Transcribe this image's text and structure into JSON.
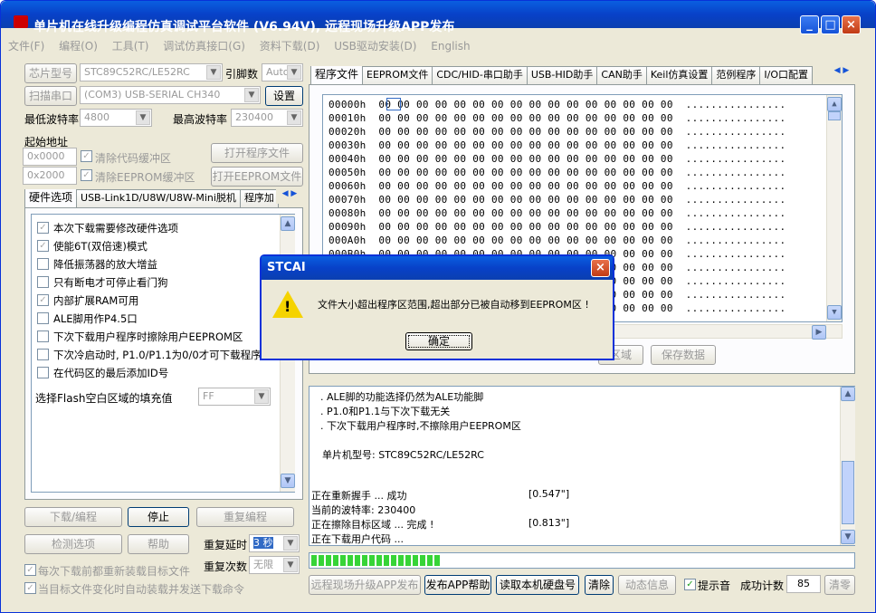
{
  "window": {
    "title": "单片机在线升级编程仿真调试平台软件 (V6.94V), 远程现场升级APP发布"
  },
  "menu": [
    "文件(F)",
    "编程(O)",
    "工具(T)",
    "调试仿真接口(G)",
    "资料下载(D)",
    "USB驱动安装(D)",
    "English"
  ],
  "left": {
    "chip_label": "芯片型号",
    "chip_value": "STC89C52RC/LE52RC",
    "pin_label": "引脚数",
    "pin_value": "Auto",
    "scan_label": "扫描串口",
    "port_value": "(COM3) USB-SERIAL CH340",
    "settings_label": "设置",
    "min_baud_label": "最低波特率",
    "min_baud_value": "4800",
    "max_baud_label": "最高波特率",
    "max_baud_value": "230400",
    "start_addr_label": "起始地址",
    "addr1_prefix": "0x",
    "addr1": "0000",
    "clear_code_label": "清除代码缓冲区",
    "open_prog_label": "打开程序文件",
    "addr2_prefix": "0x",
    "addr2": "2000",
    "clear_eeprom_label": "清除EEPROM缓冲区",
    "open_eeprom_label": "打开EEPROM文件",
    "subtabs": [
      "硬件选项",
      "USB-Link1D/U8W/U8W-Mini脱机",
      "程序加"
    ],
    "options": [
      {
        "label": "本次下载需要修改硬件选项",
        "checked": true
      },
      {
        "label": "使能6T(双倍速)模式",
        "checked": true
      },
      {
        "label": "降低振荡器的放大增益",
        "checked": false
      },
      {
        "label": "只有断电才可停止看门狗",
        "checked": false
      },
      {
        "label": "内部扩展RAM可用",
        "checked": true
      },
      {
        "label": "ALE脚用作P4.5口",
        "checked": false
      },
      {
        "label": "下次下载用户程序时擦除用户EEPROM区",
        "checked": false
      },
      {
        "label": "下次冷启动时, P1.0/P1.1为0/0才可下载程序",
        "checked": false
      },
      {
        "label": "在代码区的最后添加ID号",
        "checked": false
      }
    ],
    "fill_label": "选择Flash空白区域的填充值",
    "fill_value": "FF",
    "download_label": "下载/编程",
    "stop_label": "停止",
    "reprogram_label": "重复编程",
    "check_label": "检测选项",
    "help_label": "帮助",
    "repeat_delay_label": "重复延时",
    "repeat_delay_value": "3 秒",
    "repeat_count_label": "重复次数",
    "repeat_count_value": "无限",
    "reload_label": "每次下载前都重新装载目标文件",
    "autoload_label": "当目标文件变化时自动装载并发送下载命令"
  },
  "right": {
    "tabs": [
      "程序文件",
      "EEPROM文件",
      "CDC/HID-串口助手",
      "USB-HID助手",
      "CAN助手",
      "Keil仿真设置",
      "范例程序",
      "I/O口配置"
    ],
    "hex_rows": [
      "00000h",
      "00010h",
      "00020h",
      "00030h",
      "00040h",
      "00050h",
      "00060h",
      "00070h",
      "00080h",
      "00090h",
      "000A0h",
      "000B0h",
      "000C0h",
      "000D0h",
      "000E0h",
      "000F0h"
    ],
    "hex_bytes": "00 00 00 00 00 00 00 00 00 00 00 00 00 00 00 00",
    "ascii": "................",
    "region_btn": "区域",
    "save_btn": "保存数据",
    "log": [
      ". ALE脚的功能选择仍然为ALE功能脚",
      ". P1.0和P1.1与下次下载无关",
      ". 下次下载用户程序时,不擦除用户EEPROM区",
      "",
      "单片机型号: STC89C52RC/LE52RC"
    ],
    "status": [
      {
        "text": "正在重新握手 ... 成功",
        "time": "[0.547\"]"
      },
      {
        "text": "当前的波特率: 230400",
        "time": ""
      },
      {
        "text": "正在擦除目标区域 ... 完成 !",
        "time": "[0.813\"]"
      },
      {
        "text": "正在下载用户代码 ...",
        "time": ""
      }
    ],
    "progress": 0.24,
    "bottom": {
      "remote_label": "远程现场升级APP发布",
      "publish_help_label": "发布APP帮助",
      "read_disk_label": "读取本机硬盘号",
      "clear_label": "清除",
      "dynamic_label": "动态信息",
      "beep_label": "提示音",
      "success_label": "成功计数",
      "success_count": "85",
      "reset_label": "清零"
    }
  },
  "dialog": {
    "title": "STCAI",
    "message": "文件大小超出程序区范围,超出部分已被自动移到EEPROM区 !",
    "ok_label": "确定"
  }
}
